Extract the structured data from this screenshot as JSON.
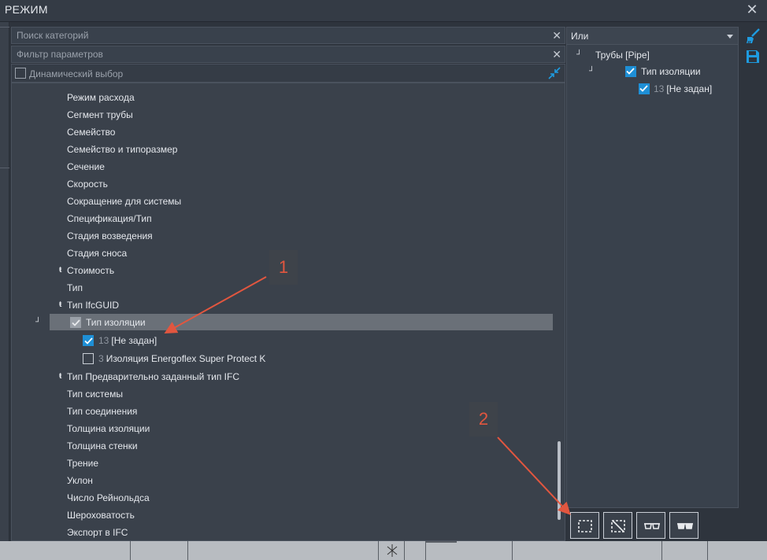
{
  "window": {
    "title": "РЕЖИМ",
    "close_glyph": "✕"
  },
  "search": {
    "placeholder": "Поиск категорий",
    "clear_glyph": "✕"
  },
  "filter": {
    "placeholder": "Фильтр параметров",
    "clear_glyph": "✕"
  },
  "dynamic_select": {
    "label": "Динамический выбор",
    "checked": false
  },
  "tree": {
    "items": [
      {
        "label": "Режим расхода"
      },
      {
        "label": "Сегмент трубы"
      },
      {
        "label": "Семейство"
      },
      {
        "label": "Семейство и типоразмер"
      },
      {
        "label": "Сечение"
      },
      {
        "label": "Скорость"
      },
      {
        "label": "Сокращение для системы"
      },
      {
        "label": "Спецификация/Тип"
      },
      {
        "label": "Стадия возведения"
      },
      {
        "label": "Стадия сноса"
      },
      {
        "label": "Стоимость",
        "expander": "ŧ"
      },
      {
        "label": "Тип"
      },
      {
        "label": "Тип IfcGUID",
        "expander": "ŧ"
      },
      {
        "label": "Тип изоляции",
        "expander": "┘",
        "selected": true
      },
      {
        "label": "[Не задан]",
        "count": "13",
        "checked": true
      },
      {
        "label": "Изоляция Energoflex Super Protect K",
        "count": "3",
        "checked": false
      },
      {
        "label": "Тип Предварительно заданный тип IFC",
        "expander": "ŧ"
      },
      {
        "label": "Тип системы"
      },
      {
        "label": "Тип соединения"
      },
      {
        "label": "Толщина изоляции"
      },
      {
        "label": "Толщина стенки"
      },
      {
        "label": "Трение"
      },
      {
        "label": "Уклон"
      },
      {
        "label": "Число Рейнольдса"
      },
      {
        "label": "Шероховатость"
      },
      {
        "label": "Экспорт в IFC"
      }
    ]
  },
  "right_panel": {
    "logic": "Или",
    "items": [
      {
        "label": "Трубы [Pipe]",
        "expander": "┘"
      },
      {
        "label": "Тип изоляции",
        "expander": "┘",
        "checked": true
      },
      {
        "label": "[Не задан]",
        "count": "13",
        "checked": true
      }
    ]
  },
  "side_icons": [
    "brush-icon",
    "save-icon"
  ],
  "bottom_buttons": [
    "select-region-icon",
    "deselect-region-icon",
    "glasses-outline-icon",
    "glasses-filled-icon"
  ],
  "callouts": [
    "1",
    "2"
  ],
  "colors": {
    "accent": "#1e8fd6",
    "annotation": "#e2563f",
    "selection": "#6a7078"
  }
}
